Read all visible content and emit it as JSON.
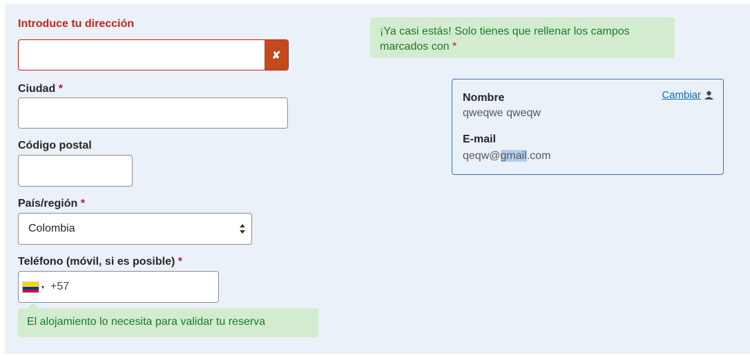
{
  "address": {
    "label": "Introduce tu dirección",
    "value": "",
    "clear_icon": "x-icon"
  },
  "city": {
    "label": "Ciudad",
    "required_mark": "*",
    "value": ""
  },
  "postal_code": {
    "label": "Código postal",
    "value": ""
  },
  "country": {
    "label": "País/región",
    "required_mark": "*",
    "selected": "Colombia"
  },
  "phone": {
    "label": "Teléfono (móvil, si es posible)",
    "required_mark": "*",
    "flag": "colombia-flag-icon",
    "caret": "▾",
    "dial_code": "+57",
    "hint": "El alojamiento lo necesita para validar tu reserva"
  },
  "top_hint": {
    "text": "¡Ya casi estás! Solo tienes que rellenar los campos marcados con",
    "required_mark": "*"
  },
  "profile_card": {
    "name_label": "Nombre",
    "name_value": "qweqwe qweqw",
    "email_label": "E-mail",
    "email_prefix": "qeqw@",
    "email_highlight": "gmail",
    "email_suffix": ".com",
    "change_link": "Cambiar",
    "change_icon": "user-icon"
  },
  "colors": {
    "background": "#ebf1f9",
    "error": "#c8231c",
    "required": "#d4111e",
    "hint_bg": "#d3ecd0",
    "hint_text": "#1a7a26",
    "link": "#0071c2",
    "clear_button": "#c24a1c"
  }
}
